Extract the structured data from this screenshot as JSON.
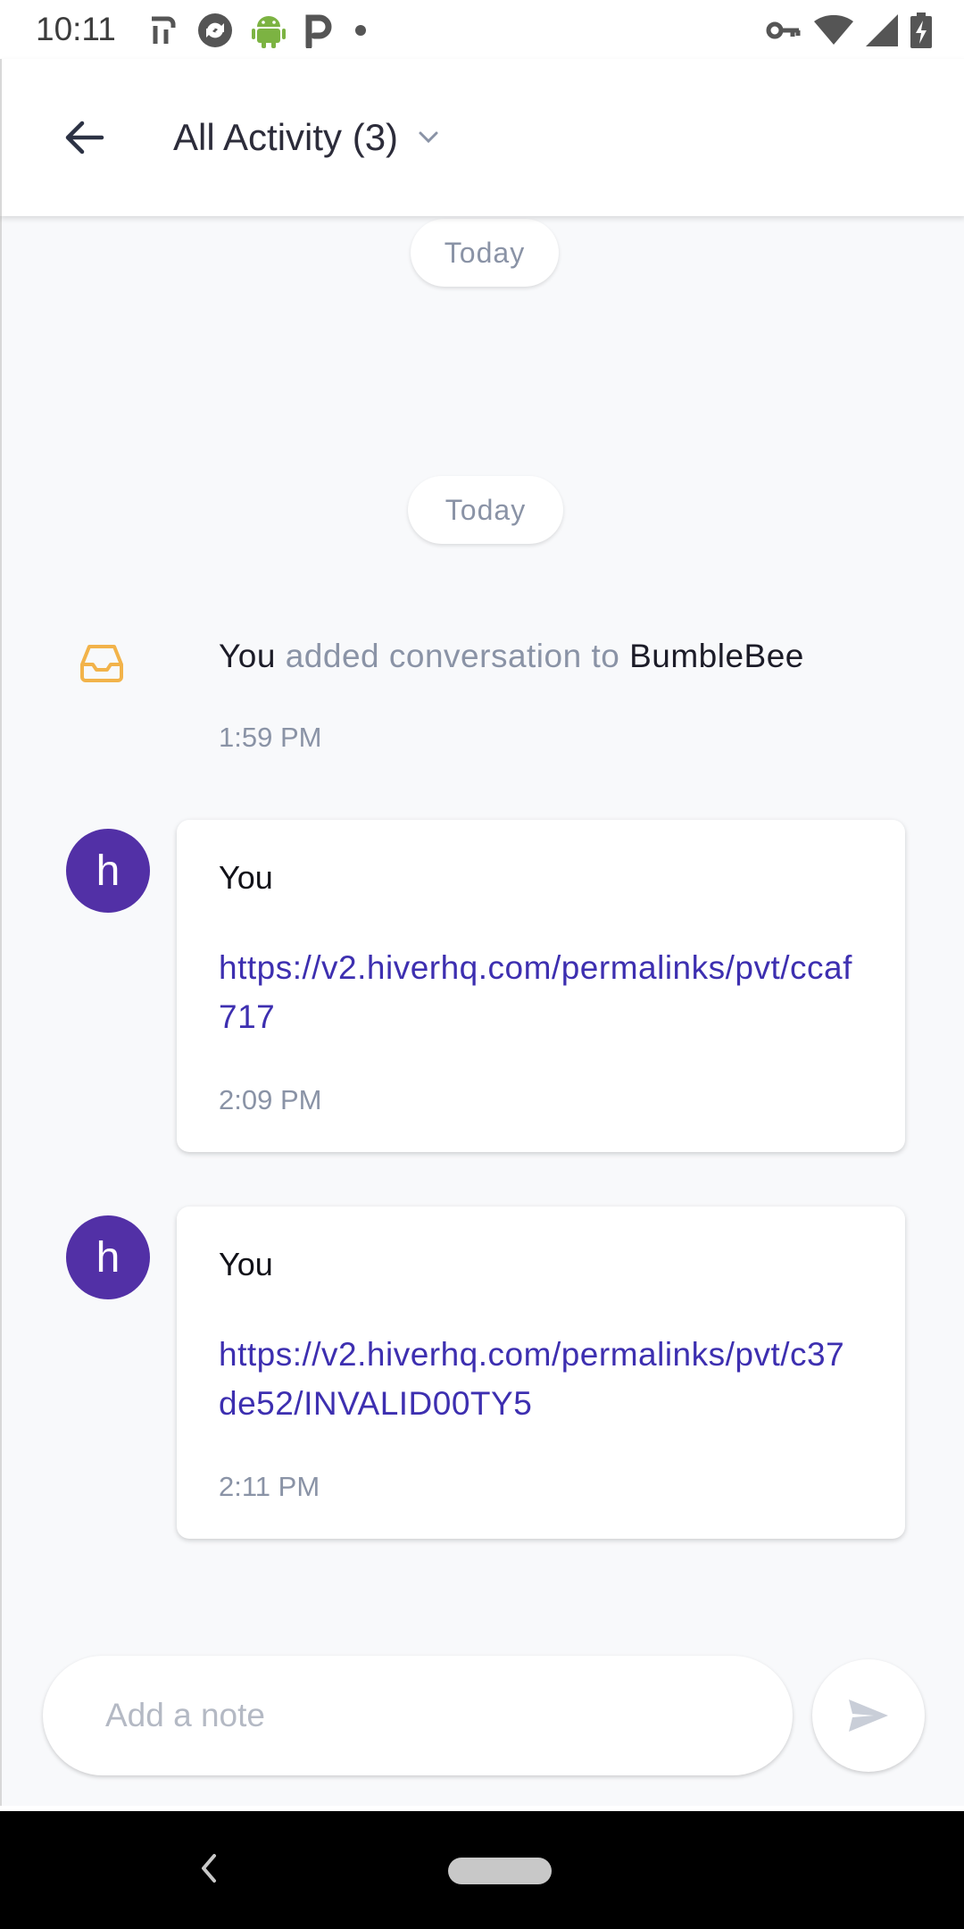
{
  "status_bar": {
    "time": "10:11",
    "left_icons": [
      "fork-icon",
      "sync-icon",
      "android-icon",
      "parking-icon",
      "dot-icon"
    ],
    "right_icons": [
      "vpn-key-icon",
      "wifi-icon",
      "signal-icon",
      "battery-charging-icon"
    ]
  },
  "header": {
    "title": "All Activity (3)"
  },
  "timeline": {
    "date_labels": [
      "Today",
      "Today"
    ],
    "activity": {
      "actor": "You",
      "action": " added conversation to ",
      "target": "BumbleBee",
      "time": "1:59 PM"
    },
    "notes": [
      {
        "avatar_letter": "h",
        "author": "You",
        "link": "https://v2.hiverhq.com/permalinks/pvt/ccaf717",
        "time": "2:09 PM"
      },
      {
        "avatar_letter": "h",
        "author": "You",
        "link": "https://v2.hiverhq.com/permalinks/pvt/c37de52/INVALID00TY5",
        "time": "2:11 PM"
      }
    ]
  },
  "composer": {
    "placeholder": "Add a note"
  },
  "colors": {
    "accent_purple": "#5230a6",
    "link": "#3d2fb0",
    "inbox_icon": "#f2b34a",
    "muted_text": "#8a93a6"
  }
}
